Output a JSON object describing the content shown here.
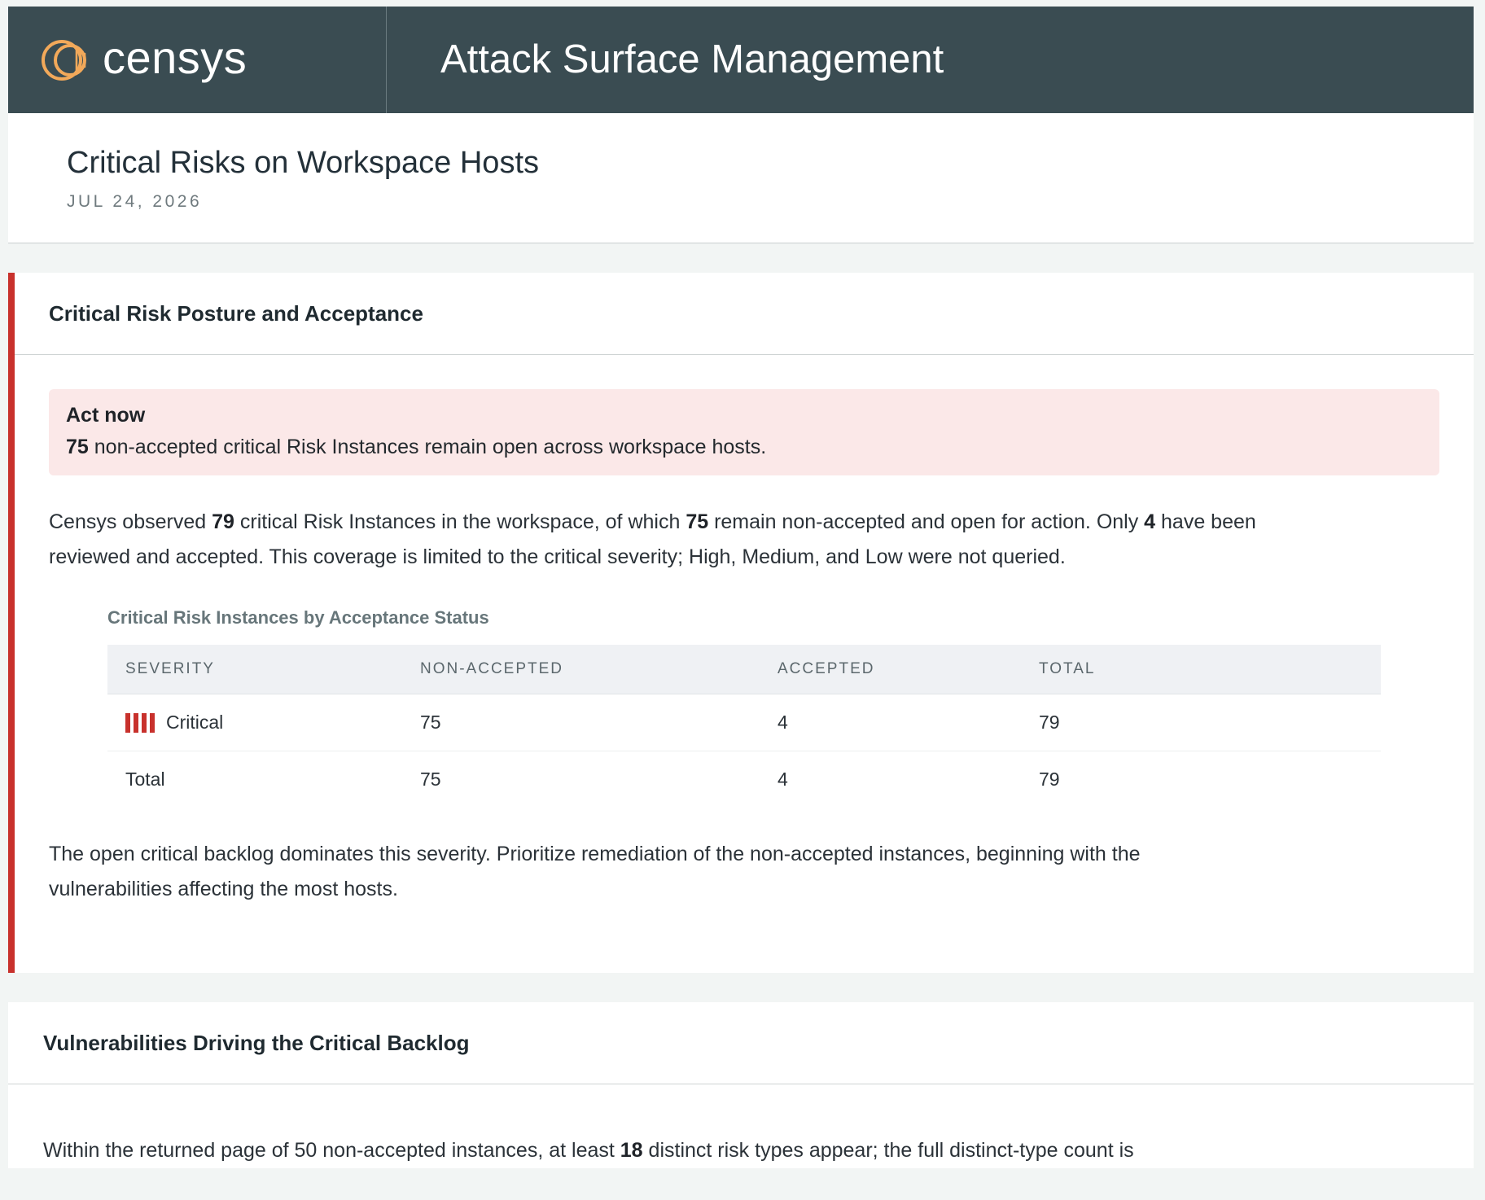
{
  "header": {
    "brand_name": "censys",
    "app_title": "Attack Surface Management"
  },
  "page": {
    "title": "Critical Risks on Workspace Hosts",
    "date": "JUL 24, 2026"
  },
  "section1": {
    "title": "Critical Risk Posture and Acceptance",
    "callout": {
      "title": "Act now",
      "count": "75",
      "text": " non-accepted critical Risk Instances remain open across workspace hosts."
    },
    "intro": {
      "p1": "Censys observed ",
      "n1": "79",
      "p2": " critical Risk Instances in the workspace, of which ",
      "n2": "75",
      "p3": " remain non-accepted and open for action. Only ",
      "n3": "4",
      "p4": " have been reviewed and accepted. This coverage is limited to the critical severity; High, Medium, and Low were not queried."
    },
    "table": {
      "caption": "Critical Risk Instances by Acceptance Status",
      "columns": [
        "SEVERITY",
        "NON-ACCEPTED",
        "ACCEPTED",
        "TOTAL"
      ],
      "rows": [
        {
          "severity": "Critical",
          "non_accepted": "75",
          "accepted": "4",
          "total": "79"
        },
        {
          "severity": "Total",
          "non_accepted": "75",
          "accepted": "4",
          "total": "79"
        }
      ],
      "severity_color": "#c8312c"
    },
    "outro": "The open critical backlog dominates this severity. Prioritize remediation of the non-accepted instances, beginning with the vulnerabilities affecting the most hosts."
  },
  "section2": {
    "title": "Vulnerabilities Driving the Critical Backlog",
    "intro": {
      "p1": "Within the returned page of 50 non-accepted instances, at least ",
      "n1": "18",
      "p2": " distinct risk types appear; the full distinct-type count is"
    }
  },
  "colors": {
    "header_bg": "#3a4c52",
    "brand_accent": "#f2a95a",
    "alert_red": "#c8312c",
    "callout_bg": "#fbe8e8",
    "page_bg": "#f2f5f4"
  },
  "icons": {
    "logo": "censys-logo-icon",
    "severity": "severity-bars-icon"
  }
}
